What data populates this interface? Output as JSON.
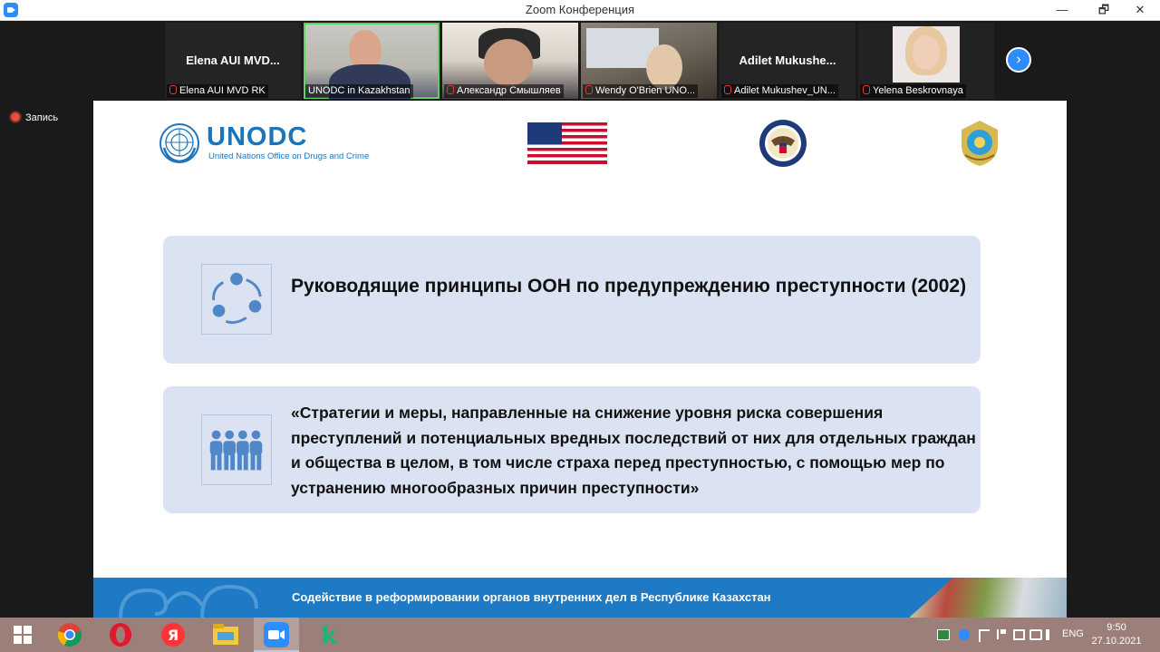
{
  "window": {
    "title": "Zoom Конференция",
    "min_label": "—",
    "max_label": "🗗",
    "close_label": "✕"
  },
  "participants": [
    {
      "display_name": "Elena AUI MVD...",
      "label": "Elena AUI MVD RK",
      "muted": true,
      "video": false
    },
    {
      "display_name": "",
      "label": "UNODC in Kazakhstan",
      "muted": false,
      "video": true,
      "active": true
    },
    {
      "display_name": "",
      "label": "Александр Смышляев",
      "muted": true,
      "video": true
    },
    {
      "display_name": "",
      "label": "Wendy O'Brien UNO...",
      "muted": true,
      "video": true
    },
    {
      "display_name": "Adilet  Mukushe...",
      "label": "Adilet Mukushev_UN...",
      "muted": true,
      "video": false
    },
    {
      "display_name": "",
      "label": "Yelena Beskrovnaya",
      "muted": true,
      "video": true
    }
  ],
  "recording": {
    "label": "Запись"
  },
  "slide": {
    "org_name": "UNODC",
    "org_subtitle": "United Nations Office on Drugs and Crime",
    "card1_text": "Руководящие принципы ООН по предупреждению преступности (2002)",
    "card2_text": "«Стратегии и меры, направленные на снижение уровня риска совершения преступлений и потенциальных вредных последствий от них для отдельных граждан и общества в целом, в том числе страха перед преступностью, с помощью мер по устранению многообразных причин преступности»",
    "footer_text": "Содействие в реформировании органов внутренних дел в Республике Казахстан"
  },
  "taskbar": {
    "language": "ENG",
    "time": "9:50",
    "date": "27.10.2021",
    "apps": [
      "windows-start",
      "chrome",
      "opera",
      "yandex",
      "file-explorer",
      "zoom",
      "k-app"
    ]
  },
  "colors": {
    "unodc_blue": "#1b75bc",
    "card_bg": "#dbe2f1",
    "footer_blue": "#1e7ac4",
    "taskbar": "#9c7f78",
    "zoom_blue": "#2d8cff"
  }
}
